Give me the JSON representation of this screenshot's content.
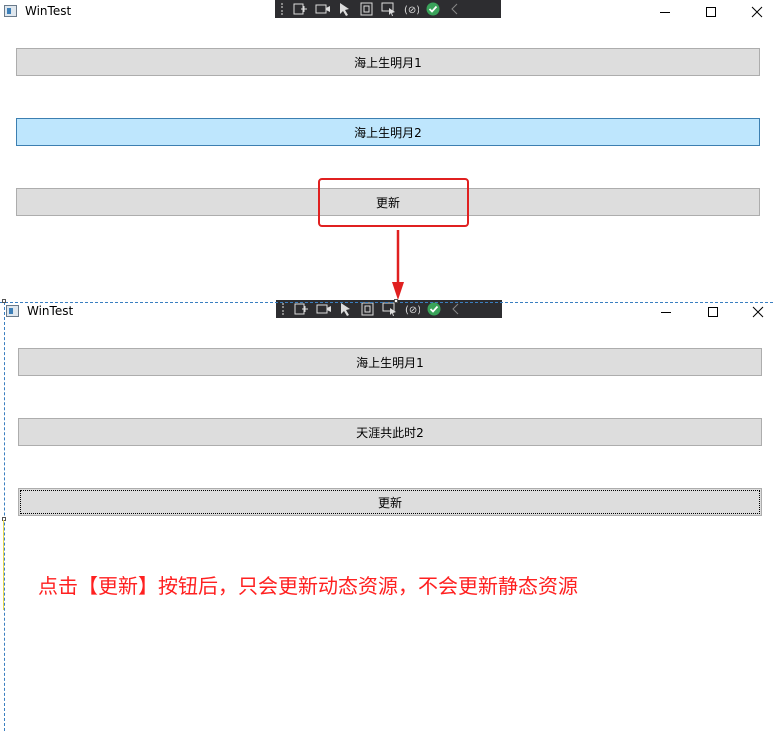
{
  "top_window": {
    "title": "WinTest",
    "buttons": [
      {
        "label": "海上生明月1"
      },
      {
        "label": "海上生明月2"
      },
      {
        "label": "更新"
      }
    ]
  },
  "bottom_window": {
    "title": "WinTest",
    "buttons": [
      {
        "label": "海上生明月1"
      },
      {
        "label": "天涯共此时2"
      },
      {
        "label": "更新"
      }
    ]
  },
  "annotation": {
    "text": "点击【更新】按钮后，只会更新动态资源，不会更新静态资源",
    "color": "#ff2020"
  },
  "colors": {
    "button_bg": "#dddddd",
    "button_hover_bg": "#bee6fd",
    "highlight_box": "#e02020",
    "devbar_bg": "#2d2d30"
  }
}
